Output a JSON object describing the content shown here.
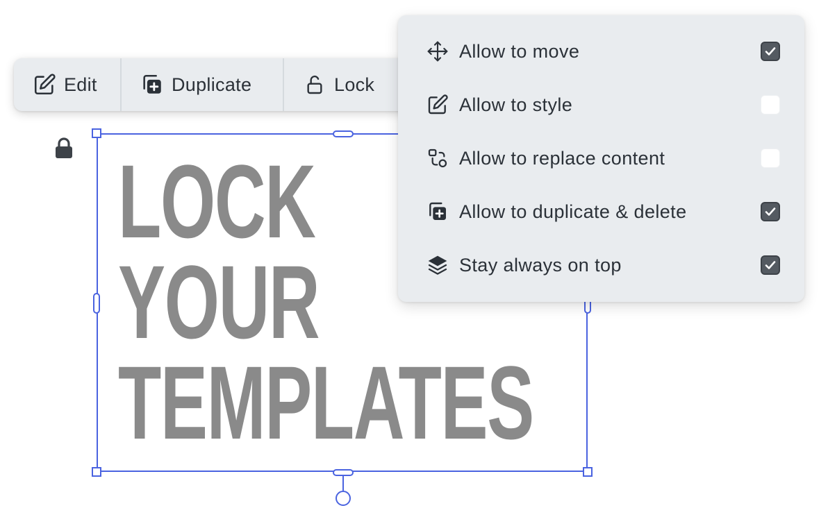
{
  "toolbar": {
    "edit_label": "Edit",
    "duplicate_label": "Duplicate",
    "lock_label": "Lock"
  },
  "canvas": {
    "headline_lines": [
      "LOCK",
      "YOUR",
      "TEMPLATES"
    ]
  },
  "lock_panel": {
    "options": [
      {
        "label": "Allow to move",
        "icon": "move-arrows-icon",
        "checked": true
      },
      {
        "label": "Allow to style",
        "icon": "pencil-edit-icon",
        "checked": false
      },
      {
        "label": "Allow to replace content",
        "icon": "replace-shapes-icon",
        "checked": false
      },
      {
        "label": "Allow to duplicate & delete",
        "icon": "duplicate-icon",
        "checked": true
      },
      {
        "label": "Stay always on top",
        "icon": "layers-icon",
        "checked": true
      }
    ]
  },
  "colors": {
    "selection": "#4a63e0",
    "headline": "#8a8a8a",
    "panel_bg": "#e9ecef",
    "checkbox_checked": "#545a61"
  }
}
